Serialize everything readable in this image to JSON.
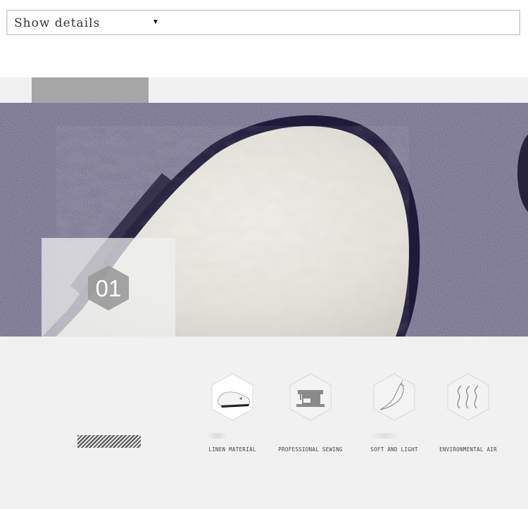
{
  "dropdown": {
    "selected": "Show details"
  },
  "panel": {
    "number": "01"
  },
  "features": [
    {
      "label": "LINEN MATERIAL",
      "icon": "shoe-icon"
    },
    {
      "label": "PROFESSIONAL SEWING",
      "icon": "sewing-machine-icon"
    },
    {
      "label": "SOFT AND LIGHT",
      "icon": "feather-icon"
    },
    {
      "label": "ENVIRONMENTAL AIR",
      "icon": "air-flow-icon"
    }
  ],
  "colors": {
    "band": "#f1f1f1",
    "tab": "#a6a6a6",
    "carpet": "#5e5878",
    "sole": "#e9e8e1",
    "rim": "#1f1a3a"
  }
}
